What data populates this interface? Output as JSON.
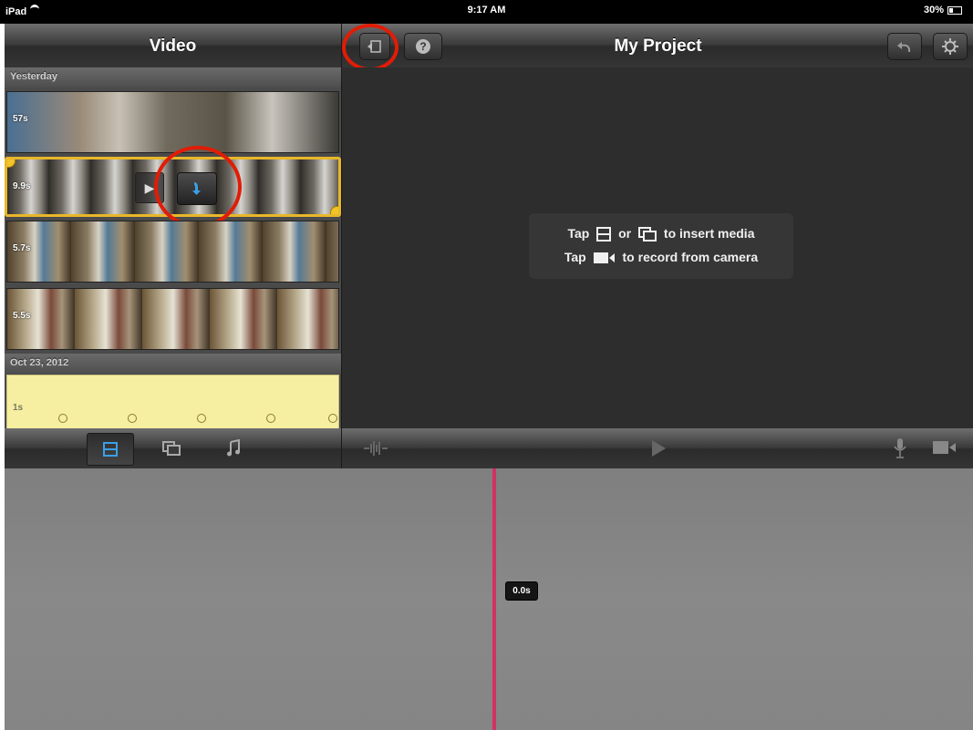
{
  "status_bar": {
    "device": "iPad",
    "time": "9:17 AM",
    "battery": "30%"
  },
  "browser": {
    "title": "Video",
    "sections": [
      {
        "label": "Yesterday"
      },
      {
        "label": "Oct 23, 2012"
      }
    ],
    "clips": [
      {
        "duration": "57s"
      },
      {
        "duration": "9.9s"
      },
      {
        "duration": "5.7s"
      },
      {
        "duration": "5.5s"
      },
      {
        "duration": "1s"
      }
    ],
    "tabs": [
      {
        "name": "video-tab",
        "icon": "film-strip-icon",
        "selected": true
      },
      {
        "name": "photos-tab",
        "icon": "photos-icon",
        "selected": false
      },
      {
        "name": "audio-tab",
        "icon": "music-note-icon",
        "selected": false
      }
    ]
  },
  "project": {
    "title": "My Project",
    "hint_line1": {
      "tap": "Tap",
      "or": "or",
      "rest": "to insert media"
    },
    "hint_line2": {
      "tap": "Tap",
      "rest": "to record from camera"
    }
  },
  "timeline": {
    "time": "0.0s"
  },
  "colors": {
    "accent": "#3aa0e8",
    "playhead": "#d23262",
    "selection": "#e8b72a",
    "highlight_ring": "#e11c06"
  }
}
